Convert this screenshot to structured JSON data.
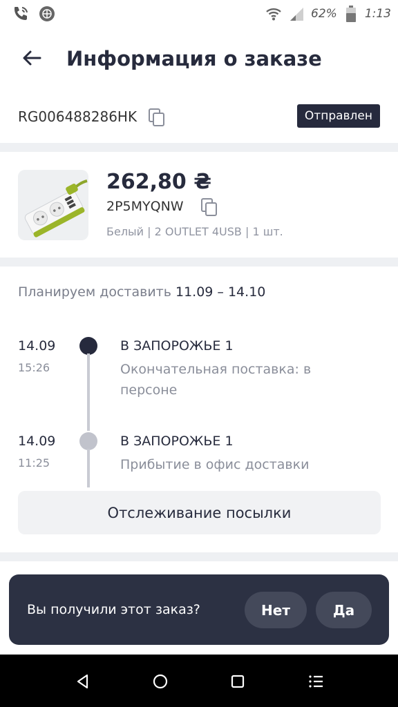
{
  "status_bar": {
    "battery": "62%",
    "time": "1:13",
    "icons": [
      "phone-wifi-icon",
      "globe-icon",
      "wifi-icon",
      "signal-icon",
      "battery-icon"
    ]
  },
  "header": {
    "title": "Информация о заказе",
    "back_icon": "arrow-left-icon"
  },
  "tracking": {
    "number": "RG006488286HK",
    "status": "Отправлен"
  },
  "product": {
    "price": "262,80 ₴",
    "order_id": "2P5MYQNW",
    "variant": "Белый | 2 OUTLET 4USB | 1 шт."
  },
  "delivery": {
    "planned_label": "Планируем доставить",
    "planned_range": "11.09 – 14.10",
    "events": [
      {
        "date": "14.09",
        "time": "15:26",
        "city": "В ЗАПОРОЖЬЕ 1",
        "desc": "Окончательная поставка: в персоне"
      },
      {
        "date": "14.09",
        "time": "11:25",
        "city": "В ЗАПОРОЖЬЕ 1",
        "desc": "Прибытие в офис доставки"
      }
    ],
    "track_button": "Отслеживание посылки"
  },
  "snackbar": {
    "question": "Вы получили этот заказ?",
    "no": "Нет",
    "yes": "Да"
  },
  "colors": {
    "dark": "#272b3d",
    "badge": "#262a3d",
    "snackbar": "#2c3143",
    "muted": "#8a8e9a"
  }
}
